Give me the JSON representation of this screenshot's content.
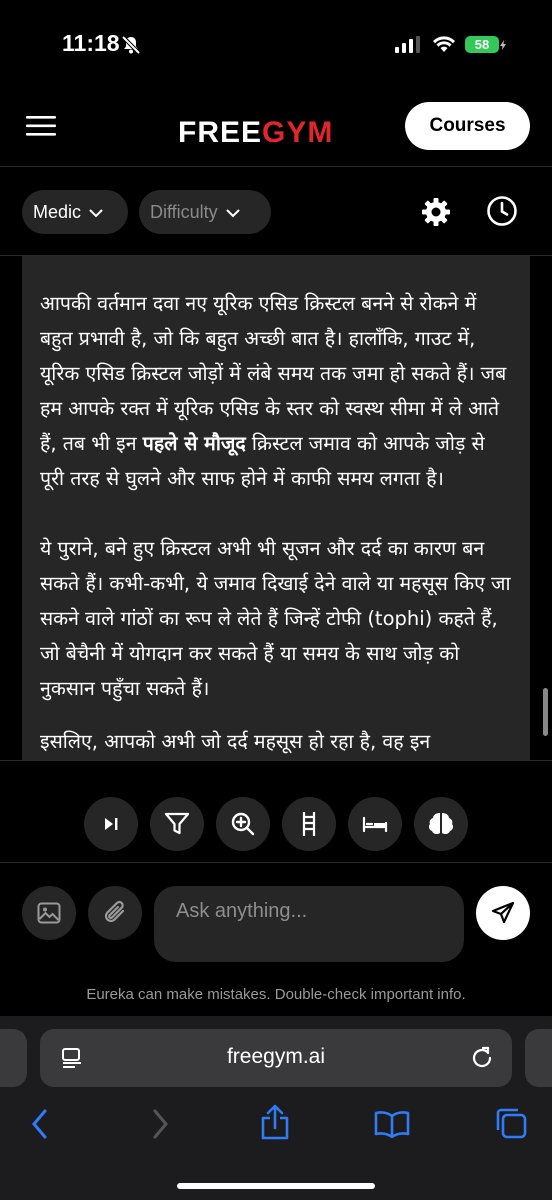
{
  "status_bar": {
    "time": "11:18",
    "battery": "58"
  },
  "header": {
    "logo_part1": "FREE",
    "logo_part2": "GYM",
    "courses_label": "Courses"
  },
  "filters": {
    "category_label": "Medic",
    "difficulty_label": "Difficulty"
  },
  "content": {
    "paragraphs": [
      "आपकी वर्तमान दवा नए यूरिक एसिड क्रिस्टल बनने से रोकने में बहुत प्रभावी है, जो कि बहुत अच्छी बात है। हालाँकि, गाउट में, यूरिक एसिड क्रिस्टल जोड़ों में लंबे समय तक जमा हो सकते हैं। जब हम आपके रक्त में यूरिक एसिड के स्तर को स्वस्थ सीमा में ले आते हैं, तब भी इन",
      "पहले से मौजूद",
      "क्रिस्टल जमाव को आपके जोड़ से पूरी तरह से घुलने और साफ होने में काफी समय लगता है।",
      "ये पुराने, बने हुए क्रिस्टल अभी भी सूजन और दर्द का कारण बन सकते हैं। कभी-कभी, ये जमाव दिखाई देने वाले या महसूस किए जा सकने वाले गांठों का रूप ले लेते हैं जिन्हें टोफी (tophi) कहते हैं, जो बेचैनी में योगदान कर सकते हैं या समय के साथ जोड़ को नुकसान पहुँचा सकते हैं।",
      "इसलिए, आपको अभी जो दर्द महसूस हो रहा है, वह इन"
    ]
  },
  "tools": [
    "skip-icon",
    "filter-icon",
    "zoom-in-icon",
    "ladder-icon",
    "bed-icon",
    "brain-icon"
  ],
  "composer": {
    "placeholder": "Ask anything...",
    "disclaimer": "Eureka can make mistakes. Double-check important info."
  },
  "browser": {
    "url": "freegym.ai"
  },
  "colors": {
    "accent_red": "#e0262b",
    "battery_green": "#33c95a",
    "ios_blue": "#2f7cf6"
  }
}
